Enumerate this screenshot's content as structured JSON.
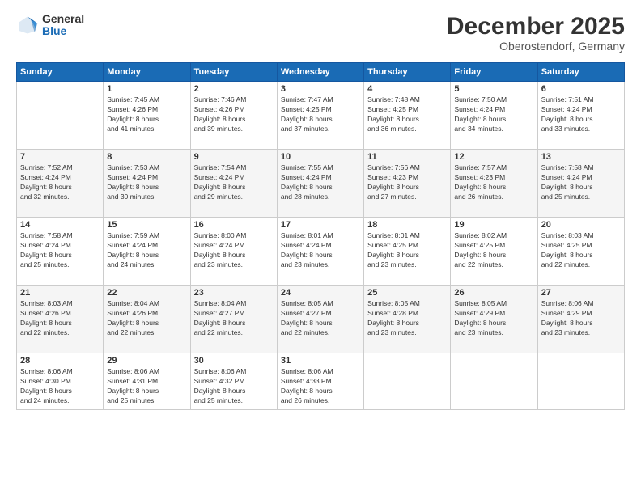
{
  "header": {
    "logo_general": "General",
    "logo_blue": "Blue",
    "month": "December 2025",
    "location": "Oberostendorf, Germany"
  },
  "weekdays": [
    "Sunday",
    "Monday",
    "Tuesday",
    "Wednesday",
    "Thursday",
    "Friday",
    "Saturday"
  ],
  "weeks": [
    [
      {
        "day": "",
        "info": ""
      },
      {
        "day": "1",
        "info": "Sunrise: 7:45 AM\nSunset: 4:26 PM\nDaylight: 8 hours\nand 41 minutes."
      },
      {
        "day": "2",
        "info": "Sunrise: 7:46 AM\nSunset: 4:26 PM\nDaylight: 8 hours\nand 39 minutes."
      },
      {
        "day": "3",
        "info": "Sunrise: 7:47 AM\nSunset: 4:25 PM\nDaylight: 8 hours\nand 37 minutes."
      },
      {
        "day": "4",
        "info": "Sunrise: 7:48 AM\nSunset: 4:25 PM\nDaylight: 8 hours\nand 36 minutes."
      },
      {
        "day": "5",
        "info": "Sunrise: 7:50 AM\nSunset: 4:24 PM\nDaylight: 8 hours\nand 34 minutes."
      },
      {
        "day": "6",
        "info": "Sunrise: 7:51 AM\nSunset: 4:24 PM\nDaylight: 8 hours\nand 33 minutes."
      }
    ],
    [
      {
        "day": "7",
        "info": "Sunrise: 7:52 AM\nSunset: 4:24 PM\nDaylight: 8 hours\nand 32 minutes."
      },
      {
        "day": "8",
        "info": "Sunrise: 7:53 AM\nSunset: 4:24 PM\nDaylight: 8 hours\nand 30 minutes."
      },
      {
        "day": "9",
        "info": "Sunrise: 7:54 AM\nSunset: 4:24 PM\nDaylight: 8 hours\nand 29 minutes."
      },
      {
        "day": "10",
        "info": "Sunrise: 7:55 AM\nSunset: 4:24 PM\nDaylight: 8 hours\nand 28 minutes."
      },
      {
        "day": "11",
        "info": "Sunrise: 7:56 AM\nSunset: 4:23 PM\nDaylight: 8 hours\nand 27 minutes."
      },
      {
        "day": "12",
        "info": "Sunrise: 7:57 AM\nSunset: 4:23 PM\nDaylight: 8 hours\nand 26 minutes."
      },
      {
        "day": "13",
        "info": "Sunrise: 7:58 AM\nSunset: 4:24 PM\nDaylight: 8 hours\nand 25 minutes."
      }
    ],
    [
      {
        "day": "14",
        "info": "Sunrise: 7:58 AM\nSunset: 4:24 PM\nDaylight: 8 hours\nand 25 minutes."
      },
      {
        "day": "15",
        "info": "Sunrise: 7:59 AM\nSunset: 4:24 PM\nDaylight: 8 hours\nand 24 minutes."
      },
      {
        "day": "16",
        "info": "Sunrise: 8:00 AM\nSunset: 4:24 PM\nDaylight: 8 hours\nand 23 minutes."
      },
      {
        "day": "17",
        "info": "Sunrise: 8:01 AM\nSunset: 4:24 PM\nDaylight: 8 hours\nand 23 minutes."
      },
      {
        "day": "18",
        "info": "Sunrise: 8:01 AM\nSunset: 4:25 PM\nDaylight: 8 hours\nand 23 minutes."
      },
      {
        "day": "19",
        "info": "Sunrise: 8:02 AM\nSunset: 4:25 PM\nDaylight: 8 hours\nand 22 minutes."
      },
      {
        "day": "20",
        "info": "Sunrise: 8:03 AM\nSunset: 4:25 PM\nDaylight: 8 hours\nand 22 minutes."
      }
    ],
    [
      {
        "day": "21",
        "info": "Sunrise: 8:03 AM\nSunset: 4:26 PM\nDaylight: 8 hours\nand 22 minutes."
      },
      {
        "day": "22",
        "info": "Sunrise: 8:04 AM\nSunset: 4:26 PM\nDaylight: 8 hours\nand 22 minutes."
      },
      {
        "day": "23",
        "info": "Sunrise: 8:04 AM\nSunset: 4:27 PM\nDaylight: 8 hours\nand 22 minutes."
      },
      {
        "day": "24",
        "info": "Sunrise: 8:05 AM\nSunset: 4:27 PM\nDaylight: 8 hours\nand 22 minutes."
      },
      {
        "day": "25",
        "info": "Sunrise: 8:05 AM\nSunset: 4:28 PM\nDaylight: 8 hours\nand 23 minutes."
      },
      {
        "day": "26",
        "info": "Sunrise: 8:05 AM\nSunset: 4:29 PM\nDaylight: 8 hours\nand 23 minutes."
      },
      {
        "day": "27",
        "info": "Sunrise: 8:06 AM\nSunset: 4:29 PM\nDaylight: 8 hours\nand 23 minutes."
      }
    ],
    [
      {
        "day": "28",
        "info": "Sunrise: 8:06 AM\nSunset: 4:30 PM\nDaylight: 8 hours\nand 24 minutes."
      },
      {
        "day": "29",
        "info": "Sunrise: 8:06 AM\nSunset: 4:31 PM\nDaylight: 8 hours\nand 25 minutes."
      },
      {
        "day": "30",
        "info": "Sunrise: 8:06 AM\nSunset: 4:32 PM\nDaylight: 8 hours\nand 25 minutes."
      },
      {
        "day": "31",
        "info": "Sunrise: 8:06 AM\nSunset: 4:33 PM\nDaylight: 8 hours\nand 26 minutes."
      },
      {
        "day": "",
        "info": ""
      },
      {
        "day": "",
        "info": ""
      },
      {
        "day": "",
        "info": ""
      }
    ]
  ]
}
